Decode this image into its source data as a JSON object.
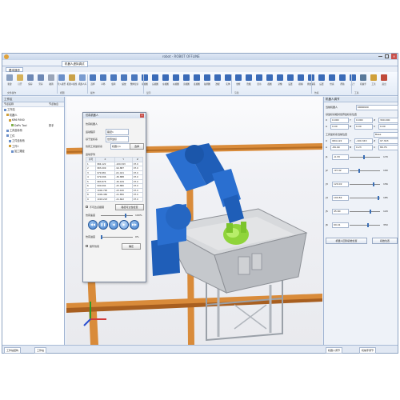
{
  "window": {
    "title": "robot - ROBOT OFFLINE"
  },
  "document_tab": "机器人虚拟调试",
  "ribbon": {
    "tab": "基本操作",
    "tools": [
      {
        "label": "新建",
        "icon": "new-icon",
        "color": "#8aa0c0"
      },
      {
        "label": "打开",
        "icon": "open-icon",
        "color": "#d6b25a"
      },
      {
        "label": "保存",
        "icon": "save-icon",
        "color": "#6d88b5"
      },
      {
        "label": "另存",
        "icon": "save-as-icon",
        "color": "#6d88b5"
      },
      {
        "label": "撤销",
        "icon": "undo-icon",
        "color": "#9aa5b8"
      },
      {
        "label": "导入模型",
        "icon": "import-model-icon",
        "color": "#6a8fc9"
      },
      {
        "label": "机器人属性",
        "icon": "robot-properties-icon",
        "color": "#c9a24a"
      },
      {
        "label": "机器人库",
        "icon": "robot-library-icon",
        "color": "#7a9cd0"
      },
      {
        "label": "选择",
        "icon": "select-icon",
        "color": "#4b78bd"
      },
      {
        "label": "平移",
        "icon": "pan-icon",
        "color": "#4b78bd"
      },
      {
        "label": "旋转",
        "icon": "rotate-icon",
        "color": "#4b78bd"
      },
      {
        "label": "缩放",
        "icon": "zoom-icon",
        "color": "#4b78bd"
      },
      {
        "label": "整体显示",
        "icon": "fit-view-icon",
        "color": "#4b78bd"
      },
      {
        "label": "前视图",
        "icon": "front-view-icon",
        "color": "#3a6bb8"
      },
      {
        "label": "后视图",
        "icon": "back-view-icon",
        "color": "#3a6bb8"
      },
      {
        "label": "左视图",
        "icon": "left-view-icon",
        "color": "#3a6bb8"
      },
      {
        "label": "右视图",
        "icon": "right-view-icon",
        "color": "#3a6bb8"
      },
      {
        "label": "顶视图",
        "icon": "top-view-icon",
        "color": "#3a6bb8"
      },
      {
        "label": "底视图",
        "icon": "bottom-view-icon",
        "color": "#3a6bb8"
      },
      {
        "label": "轴测图",
        "icon": "isometric-view-icon",
        "color": "#3a6bb8"
      },
      {
        "label": "透视",
        "icon": "perspective-icon",
        "color": "#3a6bb8"
      },
      {
        "label": "实体",
        "icon": "solid-icon",
        "color": "#3a6bb8"
      },
      {
        "label": "线框",
        "icon": "wireframe-icon",
        "color": "#3a6bb8"
      },
      {
        "label": "隐藏",
        "icon": "hide-icon",
        "color": "#3a6bb8"
      },
      {
        "label": "显示",
        "icon": "show-icon",
        "color": "#3a6bb8"
      },
      {
        "label": "截图",
        "icon": "screenshot-icon",
        "color": "#3a6bb8"
      },
      {
        "label": "录像",
        "icon": "record-icon",
        "color": "#3a6bb8"
      },
      {
        "label": "设置",
        "icon": "settings-icon",
        "color": "#3a6bb8"
      },
      {
        "label": "模拟",
        "icon": "simulate-icon",
        "color": "#3a6bb8"
      },
      {
        "label": "离线编程",
        "icon": "offline-programming-icon",
        "color": "#3a6bb8"
      },
      {
        "label": "后置",
        "icon": "post-process-icon",
        "color": "#3a6bb8"
      },
      {
        "label": "仿真",
        "icon": "simulation-icon",
        "color": "#3a6bb8"
      },
      {
        "label": "帮助",
        "icon": "help-icon",
        "color": "#3a6bb8"
      },
      {
        "label": "关于",
        "icon": "about-icon",
        "color": "#3a6bb8"
      },
      {
        "label": "机械手",
        "icon": "gripper-icon",
        "color": "#5a7a9a"
      },
      {
        "label": "工具",
        "icon": "tool-icon",
        "color": "#d0a03a"
      },
      {
        "label": "退出",
        "icon": "exit-icon",
        "color": "#c04a3a"
      }
    ],
    "groups": [
      "文件操作",
      "视图",
      "操作",
      "显示",
      "渲染",
      "仿真",
      "工具"
    ]
  },
  "left_panel": {
    "title": "工作区",
    "columns": [
      "节点名称",
      "节点信息"
    ],
    "tree": [
      {
        "label": "工作站",
        "value": "",
        "icon_color": "#6a8fc9"
      },
      {
        "label": "机器人",
        "value": "",
        "icon_color": "#d0a03a"
      },
      {
        "label": "KR6 R900",
        "value": "",
        "icon_color": "#d0a03a"
      },
      {
        "label": "DaPu Tool",
        "value": "抓手",
        "icon_color": "#7fb04a"
      },
      {
        "label": "工具坐标系",
        "value": "",
        "icon_color": "#6a8fc9"
      },
      {
        "label": "工件",
        "value": "",
        "icon_color": "#6a8fc9"
      },
      {
        "label": "工件坐标系",
        "value": "",
        "icon_color": "#6a8fc9"
      },
      {
        "label": "工件1",
        "value": "",
        "icon_color": "#d0a03a"
      },
      {
        "label": "加工路径",
        "value": "",
        "icon_color": "#6a8fc9"
      }
    ]
  },
  "dialog": {
    "title": "仿真机器人",
    "close": "x",
    "labels": {
      "robot": "仿真机器人",
      "program": "运动程序",
      "base": "基于坐标系",
      "tool": "仿真工具坐标系",
      "table_title": "运动序列"
    },
    "robot_value": "机器人1",
    "program_value": "路径1",
    "base_value": "世界坐标",
    "select_button": "选择",
    "table": {
      "headers": [
        "序号",
        "X",
        "Y",
        "Z"
      ],
      "rows": [
        [
          "1",
          "984.122",
          "-100.343",
          "97.0"
        ],
        [
          "2",
          "983.209",
          "-94.887",
          "97.0"
        ],
        [
          "3",
          "979.981",
          "-61.441",
          "97.0"
        ],
        [
          "4",
          "979.096",
          "-36.888",
          "97.0"
        ],
        [
          "5",
          "983.878",
          "-30.169",
          "97.0"
        ],
        [
          "6",
          "990.094",
          "-25.880",
          "97.0"
        ],
        [
          "7",
          "1000.795",
          "-23.160",
          "97.0"
        ],
        [
          "8",
          "1009.482",
          "-21.850",
          "97.0"
        ],
        [
          "9",
          "1018.223",
          "-21.602",
          "97.0"
        ]
      ]
    },
    "checkbox_label": "不可达点报错",
    "check_button": "路径可达性检查",
    "speed_label": "仿真速度",
    "speed_value": "100%",
    "progress_label": "仿真进度",
    "progress_value": "0%",
    "loop_label": "循环仿真",
    "ok_button": "确定",
    "speed_fraction": 0.8,
    "progress_fraction": 0.0
  },
  "right_panel": {
    "title": "机器人调节",
    "robot_label": "当前机器人",
    "robot_value": "KR6R900",
    "base_title": "基坐标系相对世界坐标系位置",
    "base_values": {
      "x": "0.000",
      "y": "0.000",
      "z": "300.000",
      "a": "0.00",
      "b": "0.00",
      "c": "0.00"
    },
    "tcp_title": "工具坐标系当前位置",
    "tcp_base": "Base",
    "tcp_values": {
      "x": "984.122",
      "y": "-100.343",
      "z": "97.343",
      "a": "-89.99",
      "b": "0.23",
      "c": "89.76"
    },
    "joints": [
      {
        "name": "J1",
        "value": "-6.33",
        "max": "170",
        "fraction": 0.48
      },
      {
        "name": "J2",
        "value": "-93.42",
        "max": "190",
        "fraction": 0.3
      },
      {
        "name": "J3",
        "value": "120.02",
        "max": "156",
        "fraction": 0.8
      },
      {
        "name": "J4",
        "value": "190.84",
        "max": "185",
        "fraction": 0.98
      },
      {
        "name": "J5",
        "value": "45.60",
        "max": "120",
        "fraction": 0.7
      },
      {
        "name": "J6",
        "value": "69.41",
        "max": "350",
        "fraction": 0.6
      }
    ],
    "buttons": [
      "机器人回到初始位置",
      "初始位置"
    ]
  },
  "status_tabs": [
    "工作站结构",
    "工作站"
  ],
  "status_tabs_right": [
    "机器人调节",
    "机械手调节"
  ]
}
